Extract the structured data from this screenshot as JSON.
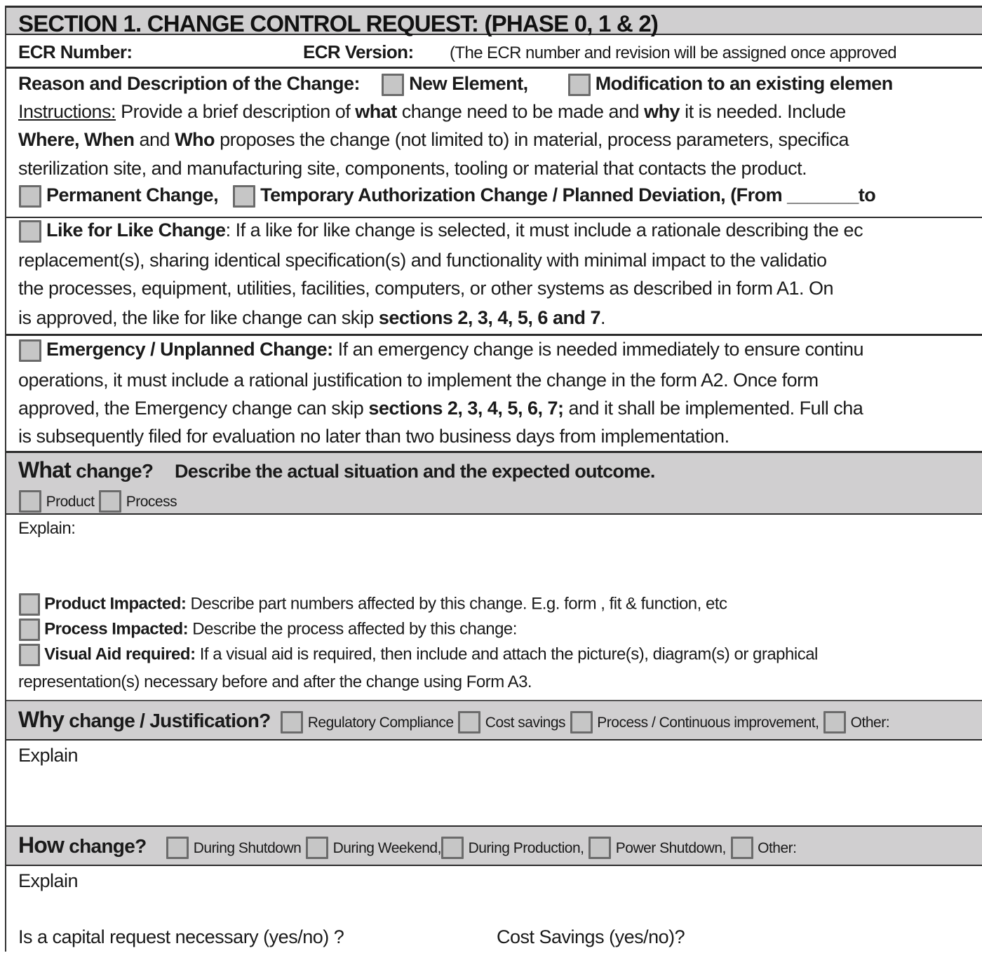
{
  "section": {
    "title": "SECTION 1. CHANGE CONTROL REQUEST: (PHASE 0, 1 & 2)"
  },
  "ecr": {
    "number_label": "ECR Number:",
    "version_label": "ECR Version:",
    "note": "(The ECR number and revision will be assigned once approved"
  },
  "reason": {
    "label": "Reason and Description of the Change:",
    "new_element": "New Element,",
    "modification": "Modification to an existing elemen",
    "instructions_label": "Instructions:",
    "line1_a": " Provide a brief description of ",
    "line1_what": "what",
    "line1_b": " change need to be made and ",
    "line1_why": "why",
    "line1_c": " it is needed. Include",
    "line2_bold1": "Where, When",
    "line2_a": " and ",
    "line2_bold2": "Who",
    "line2_b": " proposes the change (not limited to) in material, process parameters, specifica",
    "line3": "sterilization site, and manufacturing site, components, tooling or material that contacts the product.",
    "permanent": "Permanent Change,",
    "temporary": "Temporary Authorization Change / Planned Deviation, (From _______to"
  },
  "like_for_like": {
    "label": "Like for Like Change",
    "line1": ": If a like for like change is selected, it must include a rationale describing the ec",
    "line2": "replacement(s), sharing identical specification(s) and functionality with minimal impact to the validatio",
    "line3": "the processes, equipment, utilities, facilities, computers, or other systems as described in form A1.  On",
    "line4_a": "is approved, the like for like change can skip ",
    "line4_bold": "sections 2, 3, 4, 5, 6 and 7",
    "line4_b": "."
  },
  "emergency": {
    "label": "Emergency / Unplanned Change:",
    "line1": " If an emergency change is needed immediately to ensure continu",
    "line2": "operations, it must include a rational justification to implement the change in the form A2.  Once form",
    "line3_a": "approved, the Emergency change can skip ",
    "line3_bold": "sections 2, 3, 4, 5, 6, 7;",
    "line3_b": " and it shall be implemented. Full cha",
    "line4": "is subsequently filed for evaluation no later than two business days from implementation."
  },
  "what_change": {
    "title_bold": "What",
    "title_rest": " change?",
    "subtitle": "Describe the actual situation and the expected outcome.",
    "options": [
      "Product",
      "Process"
    ],
    "explain": "Explain:",
    "product_impacted_label": "Product Impacted:",
    "product_impacted_text": " Describe part numbers affected by this change. E.g. form , fit & function, etc",
    "process_impacted_label": "Process Impacted:",
    "process_impacted_text": " Describe the process affected by this change:",
    "visual_aid_label": "Visual Aid required:",
    "visual_aid_text": " If a visual aid is required, then include and attach the picture(s), diagram(s) or graphical",
    "visual_aid_text2": "representation(s) necessary before and after the change using Form A3."
  },
  "why_change": {
    "title_bold": "Why",
    "title_rest": " change / Justification?",
    "options": [
      "Regulatory Compliance",
      "Cost savings",
      "Process / Continuous improvement,",
      "Other:"
    ],
    "explain": "Explain"
  },
  "how_change": {
    "title_bold": "How",
    "title_rest": " change?",
    "options": [
      "During Shutdown",
      "During Weekend,",
      "During Production,",
      "Power Shutdown,",
      "Other:"
    ],
    "explain": "Explain",
    "capital_request": "Is a capital request necessary (yes/no) ?",
    "cost_savings": "Cost Savings (yes/no)?"
  }
}
